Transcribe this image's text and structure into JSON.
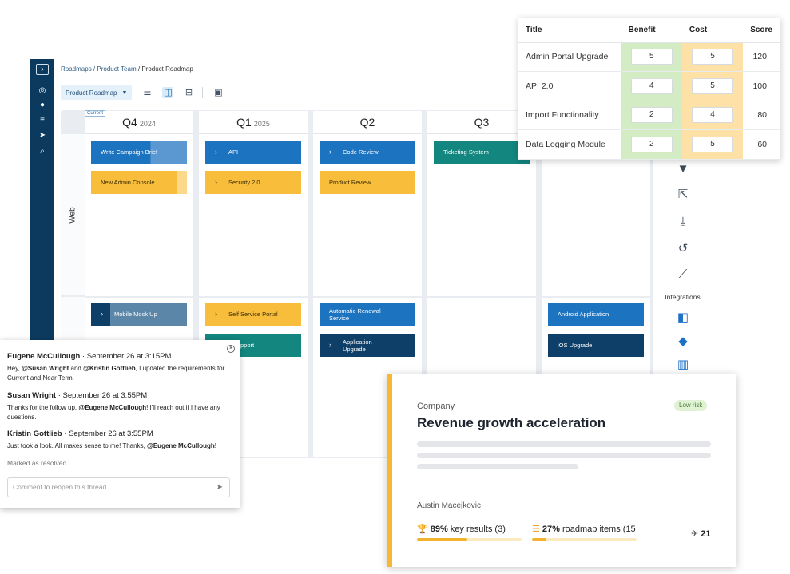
{
  "breadcrumb": {
    "part1": "Roadmaps",
    "sep1": "/",
    "part2": "Product Team",
    "sep2": "/",
    "current": "Product Roadmap"
  },
  "toolbar": {
    "roadmap_select": "Product Roadmap"
  },
  "roadmap": {
    "current_tag": "Current",
    "columns": [
      {
        "quarter": "Q4",
        "year": "2024"
      },
      {
        "quarter": "Q1",
        "year": "2025"
      },
      {
        "quarter": "Q2",
        "year": ""
      },
      {
        "quarter": "Q3",
        "year": ""
      }
    ],
    "lanes": [
      "Web"
    ],
    "cards": {
      "write_campaign_brief": "Write Campaign Brief",
      "new_admin_console": "New Admin Console",
      "api": "API",
      "security": "Security 2.0",
      "code_review": "Code Review",
      "product_review": "Product Review",
      "ticketing_system": "Ticketing System",
      "mobile_mock_up": "Mobile Mock Up",
      "self_service_portal": "Self Service Portal",
      "support": "pport",
      "automatic_renewal": "Automatic Renewal Service",
      "application_upgrade": "Application Upgrade",
      "android_application": "Android Application",
      "ios_upgrade": "iOS Upgrade"
    }
  },
  "right_toolbar": {
    "integrations_label": "Integrations"
  },
  "scoring": {
    "headers": {
      "title": "Title",
      "benefit": "Benefit",
      "cost": "Cost",
      "score": "Score"
    },
    "rows": [
      {
        "title": "Admin Portal Upgrade",
        "benefit": "5",
        "cost": "5",
        "score": "120"
      },
      {
        "title": "API 2.0",
        "benefit": "4",
        "cost": "5",
        "score": "100"
      },
      {
        "title": "Import Functionality",
        "benefit": "2",
        "cost": "4",
        "score": "80"
      },
      {
        "title": "Data Logging Module",
        "benefit": "2",
        "cost": "5",
        "score": "60"
      }
    ]
  },
  "comments": {
    "items": [
      {
        "author": "Eugene McCullough",
        "time": "September 26 at 3:15PM",
        "t1": "Hey, ",
        "m1": "@Susan Wright",
        "t2": " and ",
        "m2": "@Kristin Gottlieb",
        "t3": ", I updated the requirements for Current and Near Term."
      },
      {
        "author": "Susan Wright",
        "time": "September 26 at 3:55PM",
        "t1": "Thanks for the follow up, ",
        "m1": "@Eugene McCullough",
        "t2": "! I'll reach out if I have any questions."
      },
      {
        "author": "Kristin Gottlieb",
        "time": "September 26 at 3:55PM",
        "t1": "Just took a look. All makes sense to me! Thanks, ",
        "m1": "@Eugene McCullough",
        "t2": "!"
      }
    ],
    "resolved_text": "Marked as resolved",
    "input_placeholder": "Comment to reopen this thread..."
  },
  "okr": {
    "company": "Company",
    "title": "Revenue growth acceleration",
    "badge": "Low risk",
    "owner": "Austin Macejkovic",
    "key_results": {
      "percent": "89%",
      "label": "key results (3)",
      "progress": 0.48
    },
    "roadmap_items": {
      "percent": "27%",
      "label": "roadmap items (15",
      "progress": 0.14
    },
    "count": "21"
  }
}
